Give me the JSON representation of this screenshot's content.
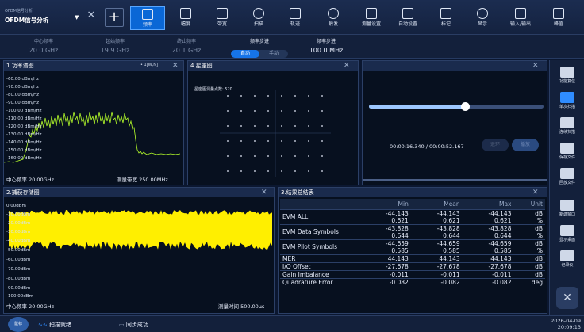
{
  "mode": {
    "sub": "OFDM信号分析",
    "title": "OFDM信号分析"
  },
  "toolbar": [
    "频率",
    "幅度",
    "带宽",
    "扫描",
    "轨迹",
    "触发",
    "测量设置",
    "自动设置",
    "标记",
    "显示",
    "输入/输出",
    "峰值"
  ],
  "freq": {
    "center_label": "中心频率",
    "center_value": "20.0 GHz",
    "start_label": "起始频率",
    "start_value": "19.9 GHz",
    "stop_label": "终止频率",
    "stop_value": "20.1 GHz",
    "step_label": "频率步进",
    "step_auto": "自动",
    "step_manual": "手动",
    "step2_label": "频率步进",
    "step2_value": "100.0 MHz"
  },
  "panel1": {
    "title": "1.功率谱图",
    "trace": "• 1[W,N]",
    "ylabels": [
      "-60.00 dBm/Hz",
      "-70.00 dBm/Hz",
      "-80.00 dBm/Hz",
      "-90.00 dBm/Hz",
      "-100.00 dBm/Hz",
      "-110.00 dBm/Hz",
      "-120.00 dBm/Hz",
      "-130.00 dBm/Hz",
      "-140.00 dBm/Hz",
      "-150.00 dBm/Hz",
      "-160.00 dBm/Hz"
    ],
    "center": "中心频率 20.00GHz",
    "bw": "测量带宽 250.00MHz"
  },
  "panel4": {
    "title": "4.星座图",
    "points": "星座图测量点数: 520"
  },
  "player": {
    "time": "00:00:16.340 / 00:00:52.167",
    "btn1": "退环",
    "btn2": "播放",
    "progress": 0.55
  },
  "panel2": {
    "title": "2.捕获存储图",
    "ylabels": [
      "0.00dBm",
      "-10.00dBm",
      "-20.00dBm",
      "-30.00dBm",
      "-40.00dBm",
      "-50.00dBm",
      "-60.00dBm",
      "-70.00dBm",
      "-80.00dBm",
      "-90.00dBm",
      "-100.00dBm"
    ],
    "center": "中心频率 20.00GHz",
    "time": "测量时间 500.00μs"
  },
  "panel3": {
    "title": "3.结果总结表",
    "headers": [
      "",
      "Min",
      "Mean",
      "Max",
      "Unit"
    ],
    "rows": [
      {
        "label": "EVM ALL",
        "vals": [
          [
            "-44.143",
            "-44.143",
            "-44.143",
            "dB"
          ],
          [
            "0.621",
            "0.621",
            "0.621",
            "%"
          ]
        ]
      },
      {
        "label": "EVM Data Symbols",
        "vals": [
          [
            "-43.828",
            "-43.828",
            "-43.828",
            "dB"
          ],
          [
            "0.644",
            "0.644",
            "0.644",
            "%"
          ]
        ]
      },
      {
        "label": "EVM Pilot Symbols",
        "vals": [
          [
            "-44.659",
            "-44.659",
            "-44.659",
            "dB"
          ],
          [
            "0.585",
            "0.585",
            "0.585",
            "%"
          ]
        ]
      },
      {
        "label": "MER",
        "vals": [
          [
            "44.143",
            "44.143",
            "44.143",
            "dB"
          ]
        ]
      },
      {
        "label": "I/Q Offset",
        "vals": [
          [
            "-27.678",
            "-27.678",
            "-27.678",
            "dB"
          ]
        ]
      },
      {
        "label": "Gain Imbalance",
        "vals": [
          [
            "-0.011",
            "-0.011",
            "-0.011",
            "dB"
          ]
        ]
      },
      {
        "label": "Quadrature Error",
        "vals": [
          [
            "-0.082",
            "-0.082",
            "-0.082",
            "deg"
          ]
        ]
      }
    ]
  },
  "rightbar": [
    "功能复位",
    "单次扫描",
    "连续扫描",
    "保存文件",
    "回放文件",
    "新建窗口",
    "显示桌面",
    "记录仪"
  ],
  "status": {
    "logo": "鼠标",
    "scan": "扫描就绪",
    "sync": "同步成功",
    "date": "2026-04-09",
    "time": "20:09:13"
  }
}
